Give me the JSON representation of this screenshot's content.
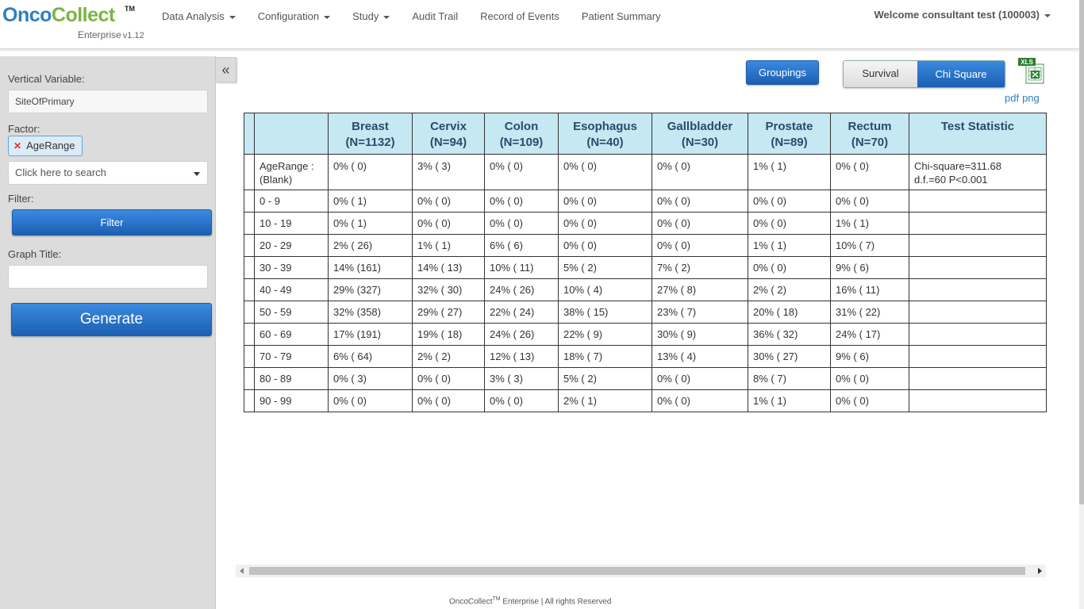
{
  "header": {
    "logo_onco": "Onco",
    "logo_collect": "Collect",
    "logo_tm": "TM",
    "logo_edition": "Enterprise",
    "logo_version": "v1.12",
    "nav": [
      {
        "label": "Data Analysis",
        "dropdown": true
      },
      {
        "label": "Configuration",
        "dropdown": true
      },
      {
        "label": "Study",
        "dropdown": true
      },
      {
        "label": "Audit Trail",
        "dropdown": false
      },
      {
        "label": "Record of Events",
        "dropdown": false
      },
      {
        "label": "Patient Summary",
        "dropdown": false
      }
    ],
    "welcome": "Welcome consultant test (100003)"
  },
  "sidebar": {
    "vertical_variable_label": "Vertical Variable:",
    "vertical_variable_value": "SiteOfPrimary",
    "factor_label": "Factor:",
    "factor_tag": "AgeRange",
    "factor_search_placeholder": "Click here to search",
    "filter_label": "Filter:",
    "filter_button": "Filter",
    "graph_title_label": "Graph Title:",
    "graph_title_value": "",
    "generate_button": "Generate",
    "collapse_icon": "«"
  },
  "toolbar": {
    "groupings_button": "Groupings",
    "survival_tab": "Survival",
    "chi_square_tab": "Chi Square",
    "xls_label": "XLS",
    "pdf_link": "pdf",
    "png_link": "png"
  },
  "table": {
    "columns": [
      {
        "name": "Breast",
        "n": "(N=1132)"
      },
      {
        "name": "Cervix",
        "n": "(N=94)"
      },
      {
        "name": "Colon",
        "n": "(N=109)"
      },
      {
        "name": "Esophagus",
        "n": "(N=40)"
      },
      {
        "name": "Gallbladder",
        "n": "(N=30)"
      },
      {
        "name": "Prostate",
        "n": "(N=89)"
      },
      {
        "name": "Rectum",
        "n": "(N=70)"
      }
    ],
    "stat_header": "Test Statistic",
    "rows": [
      {
        "label1": "AgeRange :",
        "label2": "(Blank)",
        "cells": [
          "0% ( 0)",
          "3% ( 3)",
          "0% ( 0)",
          "0% ( 0)",
          "0% ( 0)",
          "1% ( 1)",
          "0% ( 0)"
        ],
        "stat1": "Chi-square=311.68",
        "stat2": "d.f.=60 P<0.001"
      },
      {
        "label1": "0 - 9",
        "label2": "",
        "cells": [
          "0% ( 1)",
          "0% ( 0)",
          "0% ( 0)",
          "0% ( 0)",
          "0% ( 0)",
          "0% ( 0)",
          "0% ( 0)"
        ],
        "stat1": "",
        "stat2": ""
      },
      {
        "label1": "10 - 19",
        "label2": "",
        "cells": [
          "0% ( 1)",
          "0% ( 0)",
          "0% ( 0)",
          "0% ( 0)",
          "0% ( 0)",
          "0% ( 0)",
          "1% ( 1)"
        ],
        "stat1": "",
        "stat2": ""
      },
      {
        "label1": "20 - 29",
        "label2": "",
        "cells": [
          "2% ( 26)",
          "1% ( 1)",
          "6% ( 6)",
          "0% ( 0)",
          "0% ( 0)",
          "1% ( 1)",
          "10% ( 7)"
        ],
        "stat1": "",
        "stat2": ""
      },
      {
        "label1": "30 - 39",
        "label2": "",
        "cells": [
          "14% (161)",
          "14% ( 13)",
          "10% ( 11)",
          "5% ( 2)",
          "7% ( 2)",
          "0% ( 0)",
          "9% ( 6)"
        ],
        "stat1": "",
        "stat2": ""
      },
      {
        "label1": "40 - 49",
        "label2": "",
        "cells": [
          "29% (327)",
          "32% ( 30)",
          "24% ( 26)",
          "10% ( 4)",
          "27% ( 8)",
          "2% ( 2)",
          "16% ( 11)"
        ],
        "stat1": "",
        "stat2": ""
      },
      {
        "label1": "50 - 59",
        "label2": "",
        "cells": [
          "32% (358)",
          "29% ( 27)",
          "22% ( 24)",
          "38% ( 15)",
          "23% ( 7)",
          "20% ( 18)",
          "31% ( 22)"
        ],
        "stat1": "",
        "stat2": ""
      },
      {
        "label1": "60 - 69",
        "label2": "",
        "cells": [
          "17% (191)",
          "19% ( 18)",
          "24% ( 26)",
          "22% ( 9)",
          "30% ( 9)",
          "36% ( 32)",
          "24% ( 17)"
        ],
        "stat1": "",
        "stat2": ""
      },
      {
        "label1": "70 - 79",
        "label2": "",
        "cells": [
          "6% ( 64)",
          "2% ( 2)",
          "12% ( 13)",
          "18% ( 7)",
          "13% ( 4)",
          "30% ( 27)",
          "9% ( 6)"
        ],
        "stat1": "",
        "stat2": ""
      },
      {
        "label1": "80 - 89",
        "label2": "",
        "cells": [
          "0% ( 3)",
          "0% ( 0)",
          "3% ( 3)",
          "5% ( 2)",
          "0% ( 0)",
          "8% ( 7)",
          "0% ( 0)"
        ],
        "stat1": "",
        "stat2": ""
      },
      {
        "label1": "90 - 99",
        "label2": "",
        "cells": [
          "0% ( 0)",
          "0% ( 0)",
          "0% ( 0)",
          "2% ( 1)",
          "0% ( 0)",
          "1% ( 1)",
          "0% ( 0)"
        ],
        "stat1": "",
        "stat2": ""
      }
    ]
  },
  "footer": {
    "brand": "OncoCollect",
    "tm": "TM",
    "text": " Enterprise | All rights Reserved"
  }
}
